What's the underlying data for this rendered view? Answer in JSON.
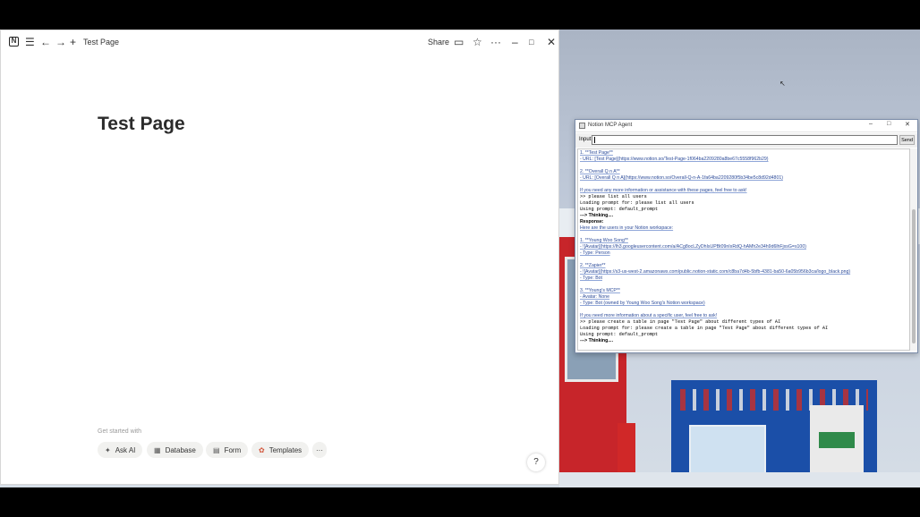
{
  "notion": {
    "breadcrumb": "Test Page",
    "share_label": "Share",
    "page_title": "Test Page",
    "get_started_label": "Get started with",
    "chips": [
      {
        "label": "Ask AI",
        "icon": "sparkle-icon"
      },
      {
        "label": "Database",
        "icon": "table-icon"
      },
      {
        "label": "Form",
        "icon": "form-icon"
      },
      {
        "label": "Templates",
        "icon": "templates-icon"
      }
    ],
    "more_chip": "···"
  },
  "agent": {
    "title": "Notion MCP Agent",
    "input_label": "Input:",
    "input_value": "",
    "send_label": "Send",
    "output_lines": [
      {
        "style": "md",
        "text": "1. **Test Page**"
      },
      {
        "style": "md",
        "text": "   - URL: [Test Page](https://www.notion.so/Test-Page-1f064ba2209280a8be67c5558f962b29)"
      },
      {
        "style": "blank",
        "text": ""
      },
      {
        "style": "md",
        "text": "2. **Overall Q n A**"
      },
      {
        "style": "md",
        "text": "   - URL: [Overall Q n A](https://www.notion.so/Overall-Q-n-A-1fa64ba2209280f5b34be5c8d92d4801)"
      },
      {
        "style": "blank",
        "text": ""
      },
      {
        "style": "md",
        "text": "If you need any more information or assistance with these pages, feel free to ask!"
      },
      {
        "style": "mono",
        "text": ">> please list all users"
      },
      {
        "style": "mono",
        "text": "Loading prompt for: please list all users"
      },
      {
        "style": "mono",
        "text": "Using prompt: default_prompt"
      },
      {
        "style": "bold",
        "text": "---> Thinking...."
      },
      {
        "style": "bold",
        "text": "Response:"
      },
      {
        "style": "md",
        "text": "Here are the users in your Notion workspace:"
      },
      {
        "style": "blank",
        "text": ""
      },
      {
        "style": "md",
        "text": "1. **Young Woo Song**"
      },
      {
        "style": "md",
        "text": "   - ![Avatar](https://lh3.googleusercontent.com/a/ACg8ocLZyDhIsUPBt09nIxRdQ-hAMh2e34h9d6lhFjxsG=s100)"
      },
      {
        "style": "md",
        "text": "   - Type: Person"
      },
      {
        "style": "blank",
        "text": ""
      },
      {
        "style": "md",
        "text": "2. **Zapier**"
      },
      {
        "style": "md",
        "text": "   - ![Avatar](https://s3-us-west-2.amazonaws.com/public.notion-static.com/c8ba7d4b-5bfb-4381-ba50-6a05b956b3ca/logo_black.png)"
      },
      {
        "style": "md",
        "text": "   - Type: Bot"
      },
      {
        "style": "blank",
        "text": ""
      },
      {
        "style": "md",
        "text": "3. **Young's MCP**"
      },
      {
        "style": "md",
        "text": "   - Avatar: None"
      },
      {
        "style": "md",
        "text": "   - Type: Bot (owned by Young Woo Song's Notion workspace)"
      },
      {
        "style": "blank",
        "text": ""
      },
      {
        "style": "md",
        "text": "If you need more information about a specific user, feel free to ask!"
      },
      {
        "style": "mono",
        "text": ">> please create a table in page \"Test Page\" about different types of AI"
      },
      {
        "style": "mono",
        "text": "Loading prompt for: please create a table in page \"Test Page\" about different types of AI"
      },
      {
        "style": "mono",
        "text": "Using prompt: default_prompt"
      },
      {
        "style": "bold",
        "text": "---> Thinking...."
      }
    ]
  }
}
